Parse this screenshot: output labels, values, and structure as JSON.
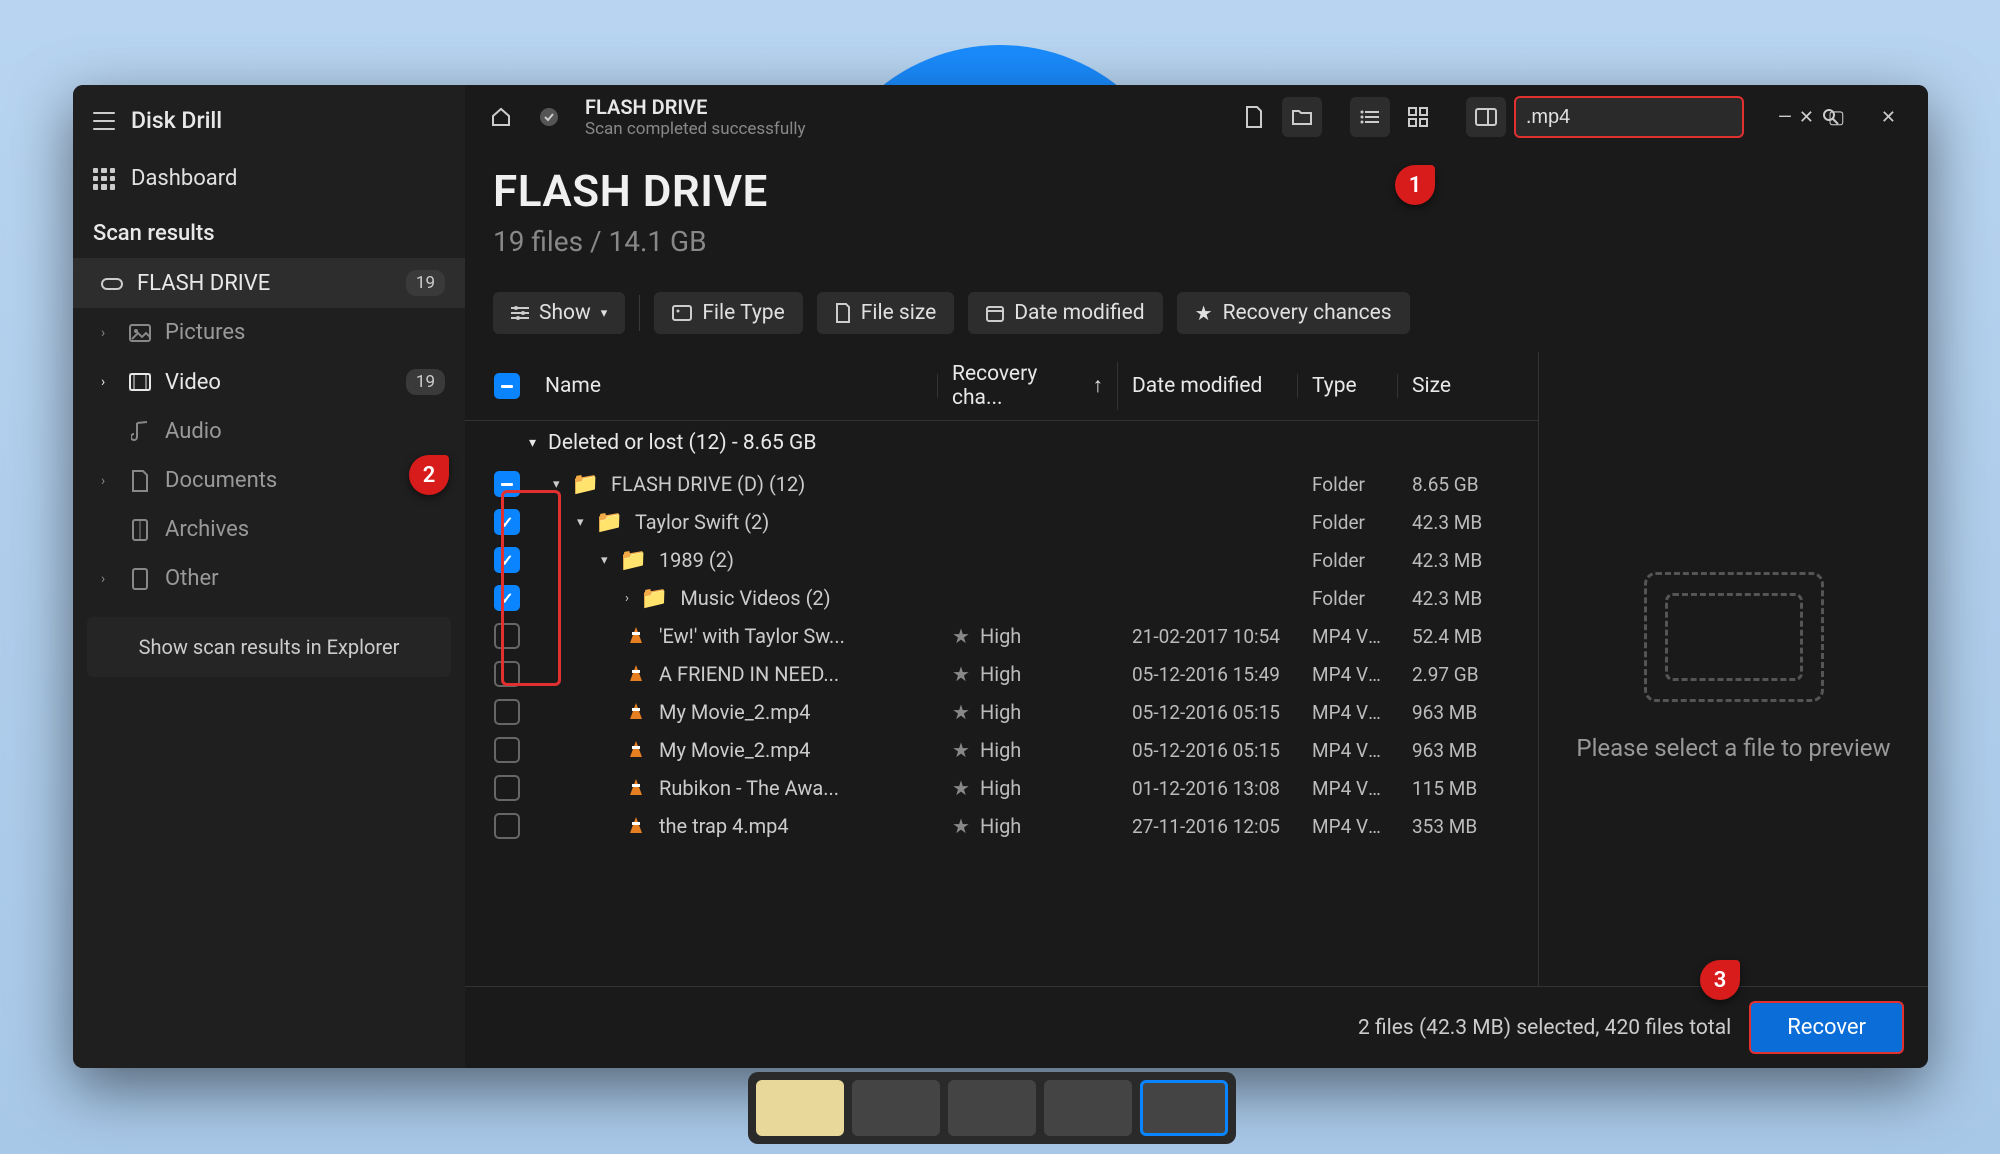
{
  "app": {
    "name": "Disk Drill"
  },
  "sidebar": {
    "dashboard": "Dashboard",
    "scan_results_label": "Scan results",
    "items": [
      {
        "label": "FLASH DRIVE",
        "badge": "19"
      },
      {
        "label": "Pictures"
      },
      {
        "label": "Video",
        "badge": "19"
      },
      {
        "label": "Audio"
      },
      {
        "label": "Documents"
      },
      {
        "label": "Archives"
      },
      {
        "label": "Other"
      }
    ],
    "footer": "Show scan results in Explorer"
  },
  "toolbar": {
    "title": "FLASH DRIVE",
    "subtitle": "Scan completed successfully",
    "search_value": ".mp4"
  },
  "header": {
    "title": "FLASH DRIVE",
    "stats": "19 files / 14.1 GB"
  },
  "filters": {
    "show": "Show",
    "file_type": "File Type",
    "file_size": "File size",
    "date_modified": "Date modified",
    "recovery_chances": "Recovery chances"
  },
  "columns": {
    "name": "Name",
    "recovery": "Recovery cha...",
    "date": "Date modified",
    "type": "Type",
    "size": "Size"
  },
  "group": {
    "label": "Deleted or lost (12) - 8.65 GB"
  },
  "rows": [
    {
      "kind": "folder",
      "indent": 1,
      "name": "FLASH DRIVE (D) (12)",
      "check": "partial",
      "type": "Folder",
      "size": "8.65 GB"
    },
    {
      "kind": "folder",
      "indent": 2,
      "name": "Taylor Swift (2)",
      "check": "checked",
      "type": "Folder",
      "size": "42.3 MB"
    },
    {
      "kind": "folder",
      "indent": 3,
      "name": "1989 (2)",
      "check": "checked",
      "type": "Folder",
      "size": "42.3 MB"
    },
    {
      "kind": "folder",
      "indent": 4,
      "name": "Music Videos (2)",
      "check": "checked",
      "type": "Folder",
      "size": "42.3 MB",
      "collapsed": true
    },
    {
      "kind": "file",
      "indent": 4,
      "name": "'Ew!' with Taylor Sw...",
      "check": "empty",
      "rec": "High",
      "date": "21-02-2017 10:54",
      "type": "MP4 Vi...",
      "size": "52.4 MB"
    },
    {
      "kind": "file",
      "indent": 4,
      "name": "A FRIEND IN NEED...",
      "check": "empty",
      "rec": "High",
      "date": "05-12-2016 15:49",
      "type": "MP4 Vi...",
      "size": "2.97 GB"
    },
    {
      "kind": "file",
      "indent": 4,
      "name": "My Movie_2.mp4",
      "check": "empty",
      "rec": "High",
      "date": "05-12-2016 05:15",
      "type": "MP4 Vi...",
      "size": "963 MB"
    },
    {
      "kind": "file",
      "indent": 4,
      "name": "My Movie_2.mp4",
      "check": "empty",
      "rec": "High",
      "date": "05-12-2016 05:15",
      "type": "MP4 Vi...",
      "size": "963 MB"
    },
    {
      "kind": "file",
      "indent": 4,
      "name": "Rubikon - The Awa...",
      "check": "empty",
      "rec": "High",
      "date": "01-12-2016 13:08",
      "type": "MP4 Vi...",
      "size": "115 MB"
    },
    {
      "kind": "file",
      "indent": 4,
      "name": "the trap 4.mp4",
      "check": "empty",
      "rec": "High",
      "date": "27-11-2016 12:05",
      "type": "MP4 Vi...",
      "size": "353 MB"
    }
  ],
  "preview": {
    "text": "Please select a file to preview"
  },
  "status": {
    "text": "2 files (42.3 MB) selected, 420 files total",
    "recover": "Recover"
  },
  "callouts": {
    "c1": "1",
    "c2": "2",
    "c3": "3"
  }
}
